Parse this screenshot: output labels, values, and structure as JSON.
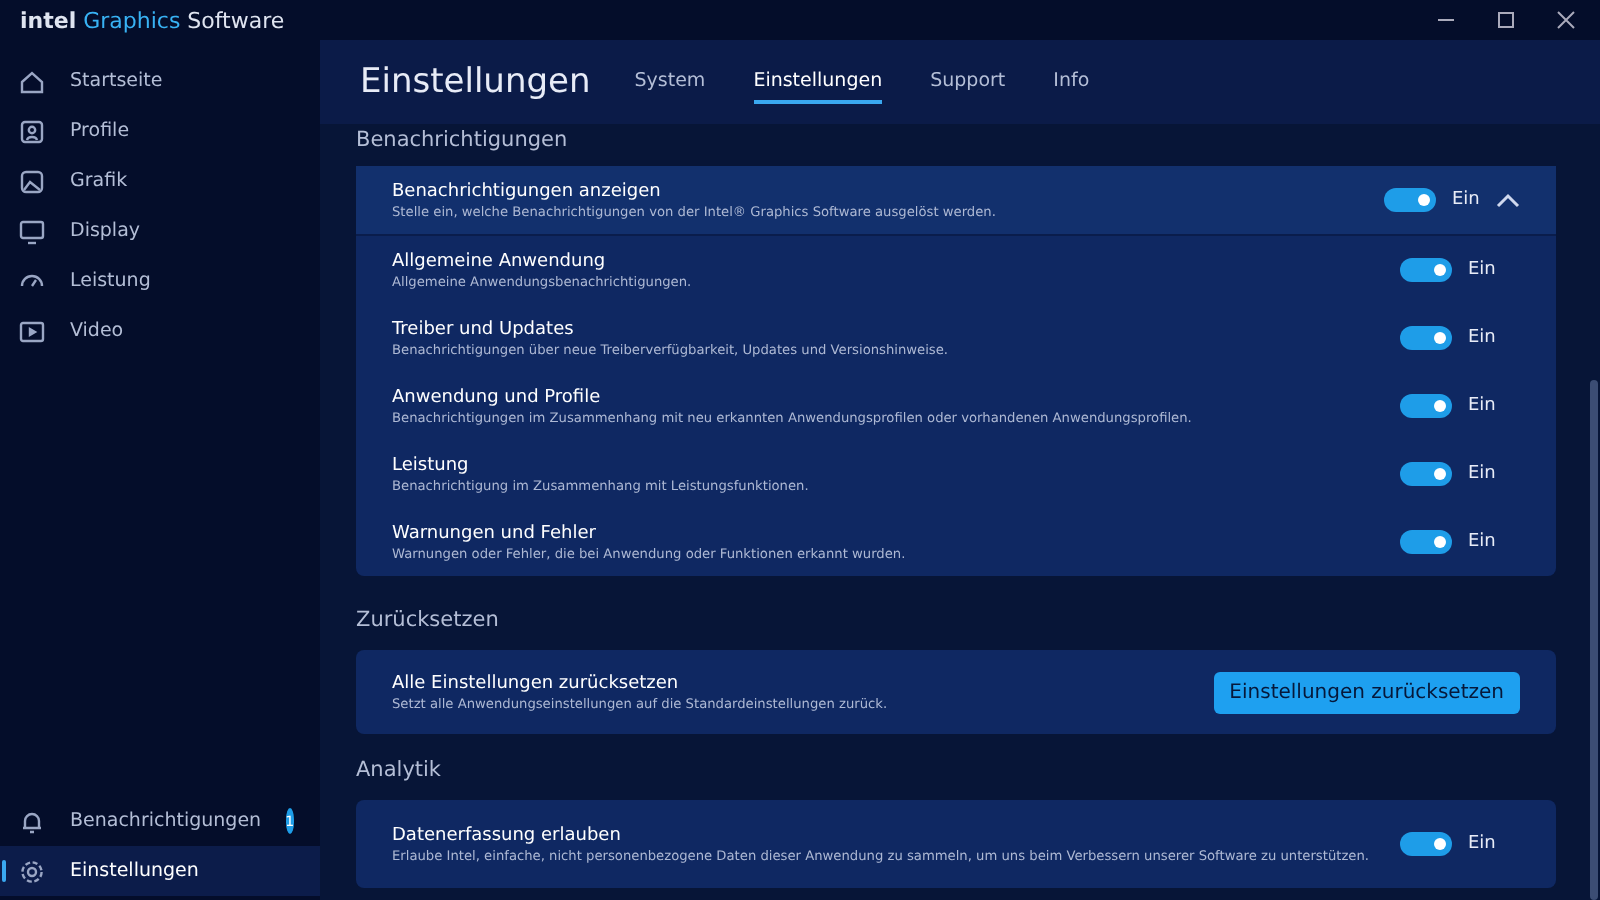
{
  "window": {
    "brand": "intel",
    "title_accent": "Graphics",
    "title_rest": "Software"
  },
  "sidebar": {
    "items": [
      {
        "label": "Startseite",
        "selected": false
      },
      {
        "label": "Profile",
        "selected": false
      },
      {
        "label": "Grafik",
        "selected": false
      },
      {
        "label": "Display",
        "selected": false
      },
      {
        "label": "Leistung",
        "selected": false
      },
      {
        "label": "Video",
        "selected": false
      }
    ],
    "bottom_items": [
      {
        "label": "Benachrichtigungen",
        "badge": "1",
        "selected": false
      },
      {
        "label": "Einstellungen",
        "selected": true
      }
    ]
  },
  "header": {
    "title": "Einstellungen",
    "tabs": [
      {
        "label": "System",
        "selected": false
      },
      {
        "label": "Einstellungen",
        "selected": true
      },
      {
        "label": "Support",
        "selected": false
      },
      {
        "label": "Info",
        "selected": false
      }
    ]
  },
  "notifications": {
    "heading": "Benachrichtigungen",
    "master": {
      "title": "Benachrichtigungen anzeigen",
      "description": "Stelle ein, welche Benachrichtigungen von der Intel® Graphics Software ausgelöst werden.",
      "on": true,
      "state": "Ein",
      "expanded": true
    },
    "items": [
      {
        "title": "Allgemeine Anwendung",
        "description": "Allgemeine Anwendungsbenachrichtigungen.",
        "on": true,
        "state": "Ein"
      },
      {
        "title": "Treiber und Updates",
        "description": "Benachrichtigungen über neue Treiberverfügbarkeit, Updates und Versionshinweise.",
        "on": true,
        "state": "Ein"
      },
      {
        "title": "Anwendung und Profile",
        "description": "Benachrichtigungen im Zusammenhang mit neu erkannten Anwendungsprofilen oder vorhandenen Anwendungsprofilen.",
        "on": true,
        "state": "Ein"
      },
      {
        "title": "Leistung",
        "description": "Benachrichtigung im Zusammenhang mit Leistungsfunktionen.",
        "on": true,
        "state": "Ein"
      },
      {
        "title": "Warnungen und Fehler",
        "description": "Warnungen oder Fehler, die bei Anwendung oder Funktionen erkannt wurden.",
        "on": true,
        "state": "Ein"
      }
    ]
  },
  "reset": {
    "heading": "Zurücksetzen",
    "title": "Alle Einstellungen zurücksetzen",
    "description": "Setzt alle Anwendungseinstellungen auf die Standardeinstellungen zurück.",
    "button": "Einstellungen zurücksetzen"
  },
  "analytics": {
    "heading": "Analytik",
    "title": "Datenerfassung erlauben",
    "description": "Erlaube Intel, einfache, nicht personenbezogene Daten dieser Anwendung zu sammeln, um uns beim Verbessern unserer Software zu unterstützen.",
    "on": true,
    "state": "Ein"
  }
}
